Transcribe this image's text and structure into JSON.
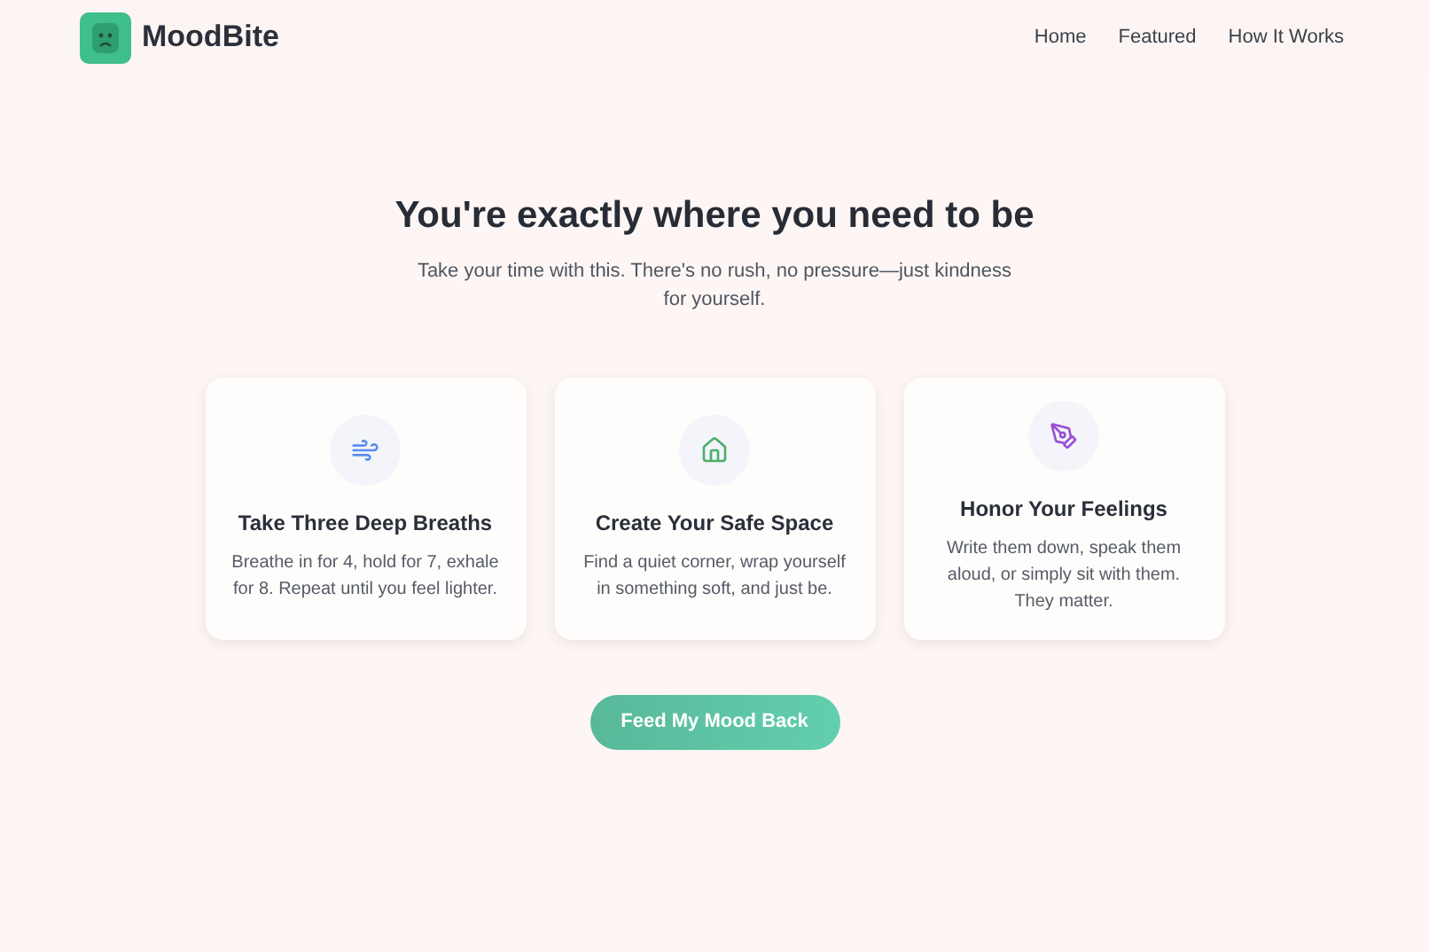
{
  "brand": {
    "name": "MoodBite"
  },
  "nav": [
    {
      "label": "Home"
    },
    {
      "label": "Featured"
    },
    {
      "label": "How It Works"
    }
  ],
  "hero": {
    "title": "You're exactly where you need to be",
    "subtitle": "Take your time with this. There's no rush, no pressure—just kindness for yourself."
  },
  "cards": [
    {
      "kind": "wind",
      "title": "Take Three Deep Breaths",
      "text": "Breathe in for 4, hold for 7, exhale for 8. Repeat until you feel lighter."
    },
    {
      "kind": "home",
      "title": "Create Your Safe Space",
      "text": "Find a quiet corner, wrap yourself in something soft, and just be."
    },
    {
      "kind": "pen",
      "title": "Honor Your Feelings",
      "text": "Write them down, speak them aloud, or simply sit with them. They matter."
    }
  ],
  "cta": {
    "label": "Feed My Mood Back"
  }
}
